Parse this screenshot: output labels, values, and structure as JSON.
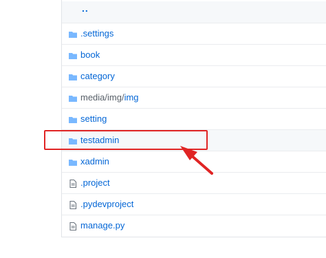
{
  "file_list": {
    "parent_dir_label": "..",
    "items": [
      {
        "name": ".settings",
        "type": "folder"
      },
      {
        "name": "book",
        "type": "folder"
      },
      {
        "name": "category",
        "type": "folder"
      },
      {
        "name_parts": [
          "media/img/",
          "img"
        ],
        "type": "folder"
      },
      {
        "name": "setting",
        "type": "folder"
      },
      {
        "name": "testadmin",
        "type": "folder"
      },
      {
        "name": "xadmin",
        "type": "folder"
      },
      {
        "name": ".project",
        "type": "file"
      },
      {
        "name": ".pydevproject",
        "type": "file"
      },
      {
        "name": "manage.py",
        "type": "file"
      }
    ]
  },
  "colors": {
    "link": "#0366d6",
    "folder_icon": "#79b8ff",
    "file_icon": "#6a737d",
    "annotation": "#e02424"
  }
}
